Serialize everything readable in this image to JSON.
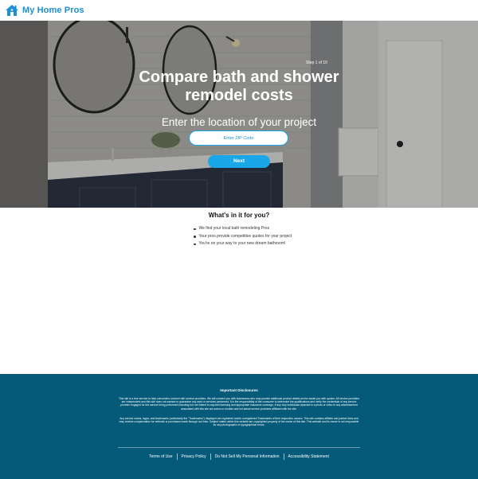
{
  "header": {
    "brand": "My Home Pros",
    "logo_icon": "house-icon",
    "accent": "#1a8fd6"
  },
  "hero": {
    "step": "Step 1 of 10",
    "title": "Compare bath and shower remodel costs",
    "subtitle": "Enter the location of your project",
    "zip_placeholder": "Enter ZIP Code",
    "zip_value": "",
    "next_label": "Next",
    "button_color": "#1aa7e8"
  },
  "benefits": {
    "title": "What's in it for you?",
    "items": [
      "We find your local bath remodeling Pros",
      "Your pros provide competitive quotes for your project",
      "You're on your way to your new dream bathroom!"
    ]
  },
  "footer": {
    "bg_color": "#065a79",
    "disclosures_title": "Important Disclosures",
    "disclosure_1": "This site is a free service to help consumers connect with service providers. We will connect you with businesses who may provide additional product details and/or assist you with quotes. All service providers are independent and this site does not warrant or guarantee any work or services performed. It is the responsibility of the consumer to determine the qualifications and verify the credentials of any service provider engaged for the service being performed including but not limited to required licensing and appropriate insurance coverage, if any. Any individuals depicted in a photo or video in any advertisement associated with this site are actors or models and not actual service providers affiliated with the site.",
    "disclosure_2": "Any service marks, logos, and trademarks (collectively the \"Trademarks\") displayed are registered and/or unregistered Trademarks of their respective owners. This site contains affiliate and partner links and may receive compensation for referrals or purchases made through our links. Subject matter within this website are copyrighted property of the owner of this site. This website and its owner is not responsible for any photographic or typographical errors.",
    "links": [
      "Terms of Use",
      "Privacy Policy",
      "Do Not Sell My Personal Information",
      "Accessibility Statement"
    ]
  }
}
